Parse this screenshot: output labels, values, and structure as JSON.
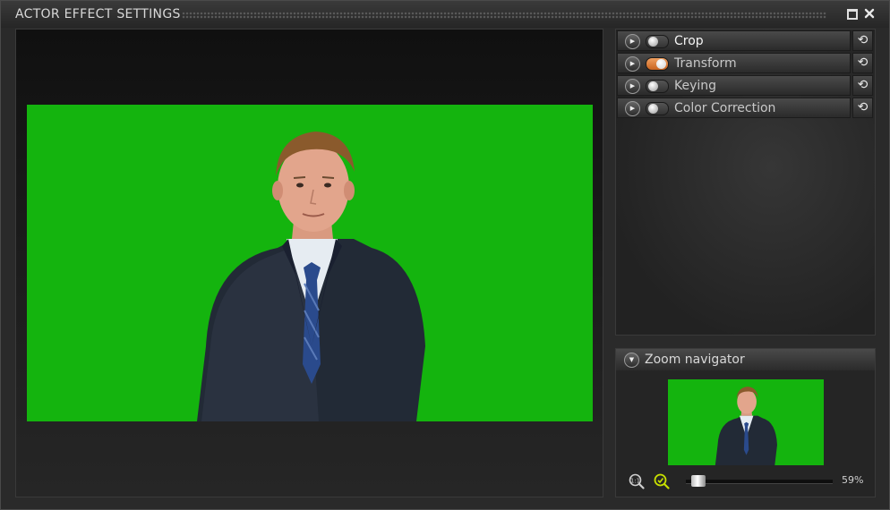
{
  "window": {
    "title": "ACTOR EFFECT SETTINGS",
    "maximize_icon": "maximize-icon",
    "close_icon": "close-icon"
  },
  "viewer": {
    "background_color": "#14b40e",
    "image_description": "presenter-on-green-screen"
  },
  "effects": {
    "items": [
      {
        "label": "Crop",
        "enabled": false,
        "icon": "play-icon",
        "reset_icon": "reset-icon"
      },
      {
        "label": "Transform",
        "enabled": true,
        "icon": "play-icon",
        "reset_icon": "reset-icon"
      },
      {
        "label": "Keying",
        "enabled": false,
        "icon": "play-icon",
        "reset_icon": "reset-icon"
      },
      {
        "label": "Color Correction",
        "enabled": false,
        "icon": "play-icon",
        "reset_icon": "reset-icon"
      }
    ],
    "active_label_color": "#f4f4f4",
    "toggle_on_color": "#e0803a"
  },
  "zoom_navigator": {
    "title": "Zoom navigator",
    "collapse_icon": "chevron-down-icon",
    "zoom_fit_icon": "zoom-fit-icon",
    "zoom_to_icon": "zoom-icon",
    "zoom_level": 0.05,
    "zoom_label": "59%"
  }
}
